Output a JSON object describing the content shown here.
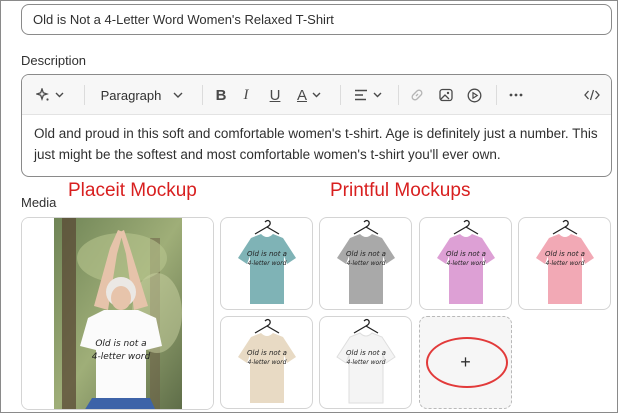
{
  "product": {
    "title_value": "Old is Not a 4-Letter Word Women's Relaxed T-Shirt"
  },
  "description": {
    "label": "Description",
    "toolbar": {
      "paragraph_label": "Paragraph",
      "icons": [
        "magic-icon",
        "bold-icon",
        "italic-icon",
        "underline-icon",
        "text-color-icon",
        "align-icon",
        "link-icon",
        "image-icon",
        "video-icon",
        "more-icon",
        "code-icon"
      ]
    },
    "body_text": "Old and proud in this soft and comfortable women's t-shirt. Age is definitely just a number. This just might be the softest and most comfortable women's t-shirt you'll ever own."
  },
  "media": {
    "label": "Media",
    "annotations": {
      "placeit": "Placeit Mockup",
      "printful": "Printful Mockups"
    },
    "shirt_text_line1": "Old is not a",
    "shirt_text_line2": "4-letter word",
    "add_label": "+",
    "colors": {
      "shirt_1": "#7fb3b6",
      "shirt_2": "#a9a9a9",
      "shirt_3": "#dda0d5",
      "shirt_4": "#f2a9b5",
      "shirt_5": "#e8dac4",
      "shirt_6": "#f4f4f4"
    }
  },
  "colors": {
    "annotation_red": "#d81f1f",
    "border": "#8a8a8a",
    "toolbar_bg": "#f7f7f7"
  }
}
